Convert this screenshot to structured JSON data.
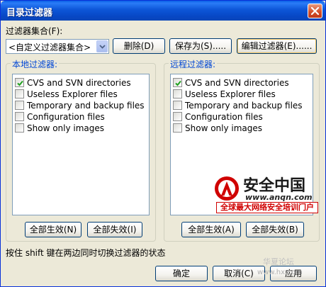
{
  "window": {
    "title": "目录过滤器"
  },
  "filter_set": {
    "label": "过滤器集合(F):",
    "selected": "<自定义过滤器集合>",
    "delete_label": "删除(D)",
    "save_as_label": "保存为(S).....",
    "edit_label": "编辑过滤器(E)......"
  },
  "local": {
    "title": "本地过滤器:",
    "items": [
      {
        "label": "CVS and SVN directories",
        "checked": true
      },
      {
        "label": "Useless Explorer files",
        "checked": false
      },
      {
        "label": "Temporary and backup files",
        "checked": false
      },
      {
        "label": "Configuration files",
        "checked": false
      },
      {
        "label": "Show only images",
        "checked": false
      }
    ],
    "enable_all_label": "全部生效(N)",
    "disable_all_label": "全部失效(I)"
  },
  "remote": {
    "title": "远程过滤器:",
    "items": [
      {
        "label": "CVS and SVN directories",
        "checked": true
      },
      {
        "label": "Useless Explorer files",
        "checked": false
      },
      {
        "label": "Temporary and backup files",
        "checked": false
      },
      {
        "label": "Configuration files",
        "checked": false
      },
      {
        "label": "Show only images",
        "checked": false
      }
    ],
    "enable_all_label": "全部生效(A)",
    "disable_all_label": "全部失效(B)"
  },
  "hint": "按住 shift 键在两边同时切换过滤器的状态",
  "footer": {
    "ok_label": "确定",
    "cancel_label": "取消(C)",
    "apply_label": "应用"
  },
  "watermark": {
    "name": "安全中国",
    "url": "www.anqn.com",
    "slogan": "全球最大网络安全培训门户",
    "faint_1": "华夏论坛",
    "faint_2": "www.hx.com"
  },
  "colors": {
    "titlebar": "#0a5fe6",
    "dialog_bg": "#ece9d8",
    "group_title": "#0046d5",
    "watermark_red": "#d00000"
  }
}
